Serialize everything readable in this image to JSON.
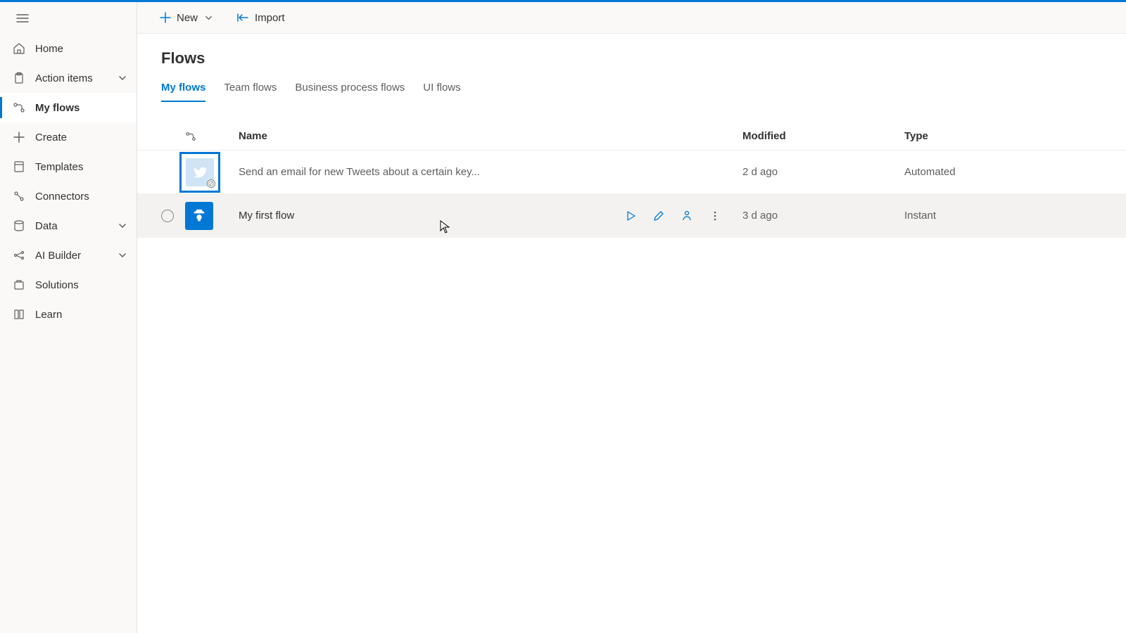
{
  "sidebar": {
    "items": [
      {
        "label": "Home"
      },
      {
        "label": "Action items"
      },
      {
        "label": "My flows"
      },
      {
        "label": "Create"
      },
      {
        "label": "Templates"
      },
      {
        "label": "Connectors"
      },
      {
        "label": "Data"
      },
      {
        "label": "AI Builder"
      },
      {
        "label": "Solutions"
      },
      {
        "label": "Learn"
      }
    ]
  },
  "commandbar": {
    "new_label": "New",
    "import_label": "Import"
  },
  "page": {
    "title": "Flows"
  },
  "tabs": [
    {
      "label": "My flows"
    },
    {
      "label": "Team flows"
    },
    {
      "label": "Business process flows"
    },
    {
      "label": "UI flows"
    }
  ],
  "columns": {
    "name": "Name",
    "modified": "Modified",
    "type": "Type"
  },
  "rows": [
    {
      "name": "Send an email for new Tweets about a certain key...",
      "modified": "2 d ago",
      "type": "Automated"
    },
    {
      "name": "My first flow",
      "modified": "3 d ago",
      "type": "Instant"
    }
  ]
}
